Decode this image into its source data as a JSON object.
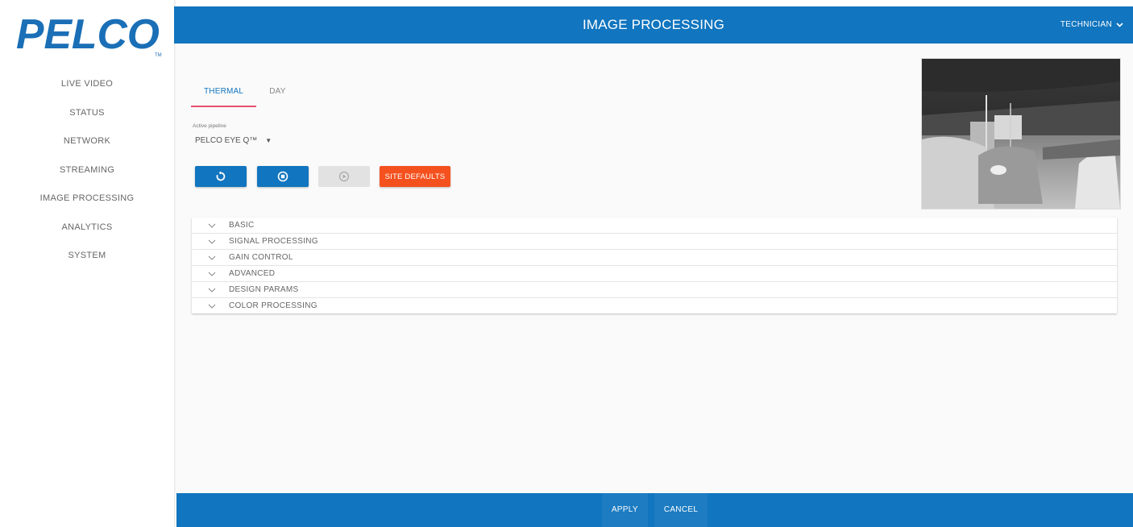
{
  "brand": {
    "logo_text": "PELCO",
    "trademark": "TM"
  },
  "header": {
    "title": "IMAGE PROCESSING",
    "user_menu": "TECHNICIAN"
  },
  "sidebar": {
    "items": [
      {
        "label": "LIVE VIDEO"
      },
      {
        "label": "STATUS"
      },
      {
        "label": "NETWORK"
      },
      {
        "label": "STREAMING"
      },
      {
        "label": "IMAGE PROCESSING"
      },
      {
        "label": "ANALYTICS"
      },
      {
        "label": "SYSTEM"
      }
    ]
  },
  "tabs": [
    {
      "label": "THERMAL",
      "active": true
    },
    {
      "label": "DAY",
      "active": false
    }
  ],
  "pipeline": {
    "label": "Active pipeline",
    "value": "PELCO EYE Q™"
  },
  "actions": {
    "reset_icon": "reset-icon",
    "stop_icon": "stop-circle-icon",
    "play_icon": "play-circle-icon",
    "site_defaults_label": "SITE DEFAULTS"
  },
  "sections": [
    {
      "label": "BASIC"
    },
    {
      "label": "SIGNAL PROCESSING"
    },
    {
      "label": "GAIN CONTROL"
    },
    {
      "label": "ADVANCED"
    },
    {
      "label": "DESIGN PARAMS"
    },
    {
      "label": "COLOR PROCESSING"
    }
  ],
  "footer": {
    "apply_label": "APPLY",
    "cancel_label": "CANCEL"
  },
  "colors": {
    "primary": "#1175bf",
    "accent": "#f4511e",
    "tab_indicator": "#e8506f"
  }
}
